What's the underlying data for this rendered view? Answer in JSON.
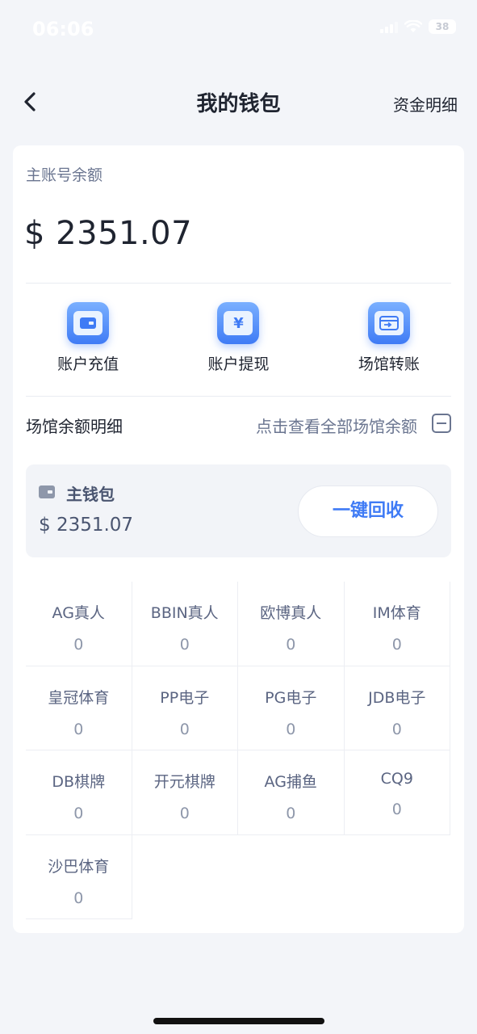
{
  "status_bar": {
    "time": "06:06",
    "battery": "38"
  },
  "nav": {
    "title": "我的钱包",
    "right_link": "资金明细"
  },
  "main_balance": {
    "label": "主账号余额",
    "value": "$ 2351.07"
  },
  "actions": [
    {
      "label": "账户充值",
      "icon": "wallet-icon"
    },
    {
      "label": "账户提现",
      "icon": "yen-icon"
    },
    {
      "label": "场馆转账",
      "icon": "transfer-icon"
    }
  ],
  "venue_section": {
    "title": "场馆余额明细",
    "link": "点击查看全部场馆余额"
  },
  "main_wallet": {
    "name": "主钱包",
    "amount": "$ 2351.07",
    "recall_button": "一键回收"
  },
  "venues": [
    {
      "name": "AG真人",
      "value": "0"
    },
    {
      "name": "BBIN真人",
      "value": "0"
    },
    {
      "name": "欧博真人",
      "value": "0"
    },
    {
      "name": "IM体育",
      "value": "0"
    },
    {
      "name": "皇冠体育",
      "value": "0"
    },
    {
      "name": "PP电子",
      "value": "0"
    },
    {
      "name": "PG电子",
      "value": "0"
    },
    {
      "name": "JDB电子",
      "value": "0"
    },
    {
      "name": "DB棋牌",
      "value": "0"
    },
    {
      "name": "开元棋牌",
      "value": "0"
    },
    {
      "name": "AG捕鱼",
      "value": "0"
    },
    {
      "name": "CQ9",
      "value": "0"
    },
    {
      "name": "沙巴体育",
      "value": "0"
    }
  ]
}
